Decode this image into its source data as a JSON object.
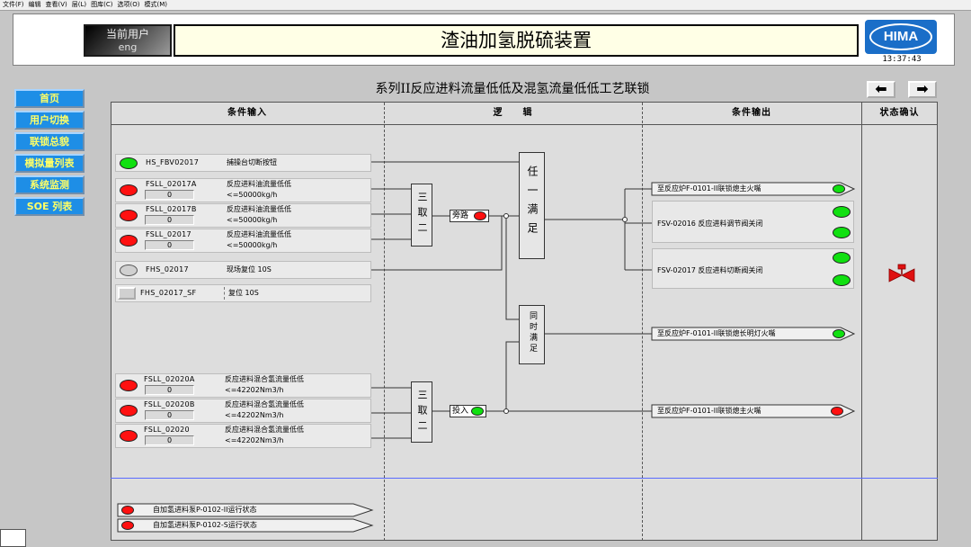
{
  "menu": [
    "文件(F)",
    "编辑",
    "查看(V)",
    "层(L)",
    "图库(C)",
    "选项(O)",
    "模式(M)"
  ],
  "header": {
    "user_label": "当前用户",
    "user_name": "eng",
    "title": "渣油加氢脱硫装置",
    "logo_text": "HIMA",
    "time": "13:37:43"
  },
  "nav": [
    "首页",
    "用户切换",
    "联锁总貌",
    "模拟量列表",
    "系统监测",
    "SOE 列表"
  ],
  "page_title": "系列II反应进料流量低低及混氢流量低低工艺联锁",
  "arrows": {
    "prev": "⬅",
    "next": "➡"
  },
  "columns": [
    "条件输入",
    "逻　　辑",
    "条件输出",
    "状态确认"
  ],
  "inputs": {
    "hs": {
      "tag": "HS_FBV02017",
      "desc": "捕操台切断按钮",
      "state": "green"
    },
    "feed_rows": [
      {
        "tag": "FSLL_02017A",
        "value": "0",
        "desc1": "反应进料油流量低低",
        "desc2": "<=50000kg/h",
        "state": "red"
      },
      {
        "tag": "FSLL_02017B",
        "value": "0",
        "desc1": "反应进料油流量低低",
        "desc2": "<=50000kg/h",
        "state": "red"
      },
      {
        "tag": "FSLL_02017",
        "value": "0",
        "desc1": "反应进料油流量低低",
        "desc2": "<=50000kg/h",
        "state": "red"
      }
    ],
    "fhs": {
      "tag": "FHS_02017",
      "desc": "现场复位 10S",
      "state": "gray"
    },
    "fhs_sf": {
      "tag": "FHS_02017_SF",
      "desc": "复位 10S"
    },
    "h2_rows": [
      {
        "tag": "FSLL_02020A",
        "value": "0",
        "desc1": "反应进料混合氢流量低低",
        "desc2": "<=42202Nm3/h",
        "state": "red"
      },
      {
        "tag": "FSLL_02020B",
        "value": "0",
        "desc1": "反应进料混合氢流量低低",
        "desc2": "<=42202Nm3/h",
        "state": "red"
      },
      {
        "tag": "FSLL_02020",
        "value": "0",
        "desc1": "反应进料混合氢流量低低",
        "desc2": "<=42202Nm3/h",
        "state": "red"
      }
    ]
  },
  "logic": {
    "vote1": "三取二",
    "vote2": "三取二",
    "bypass": {
      "label": "旁路",
      "state": "red"
    },
    "enable": {
      "label": "投入",
      "state": "green"
    },
    "any": "任一满足",
    "both": "同时满足"
  },
  "outputs": {
    "o1": {
      "text": "至反应炉F-0101-II联锁熄主火嘴",
      "state": "green"
    },
    "o2": {
      "text": "FSV-02016 反应进料调节阀关闭",
      "state": "green"
    },
    "o3": {
      "text": "FSV-02017 反应进料切断阀关闭",
      "state": "green"
    },
    "o4": {
      "text": "至反应炉F-0101-II联锁熄长明灯火嘴",
      "state": "green"
    },
    "o5": {
      "text": "至反应炉F-0101-II联锁熄主火嘴",
      "state": "red"
    }
  },
  "bottom": [
    {
      "text": "自加氢进料泵P-0102-II运行状态",
      "state": "red"
    },
    {
      "text": "自加氢进料泵P-0102-S运行状态",
      "state": "red"
    }
  ],
  "colors": {
    "red": "#ff1010",
    "green": "#10e010",
    "nav_bg": "#1e8ee6",
    "nav_text": "#ffff66",
    "valve": "#e01010"
  }
}
